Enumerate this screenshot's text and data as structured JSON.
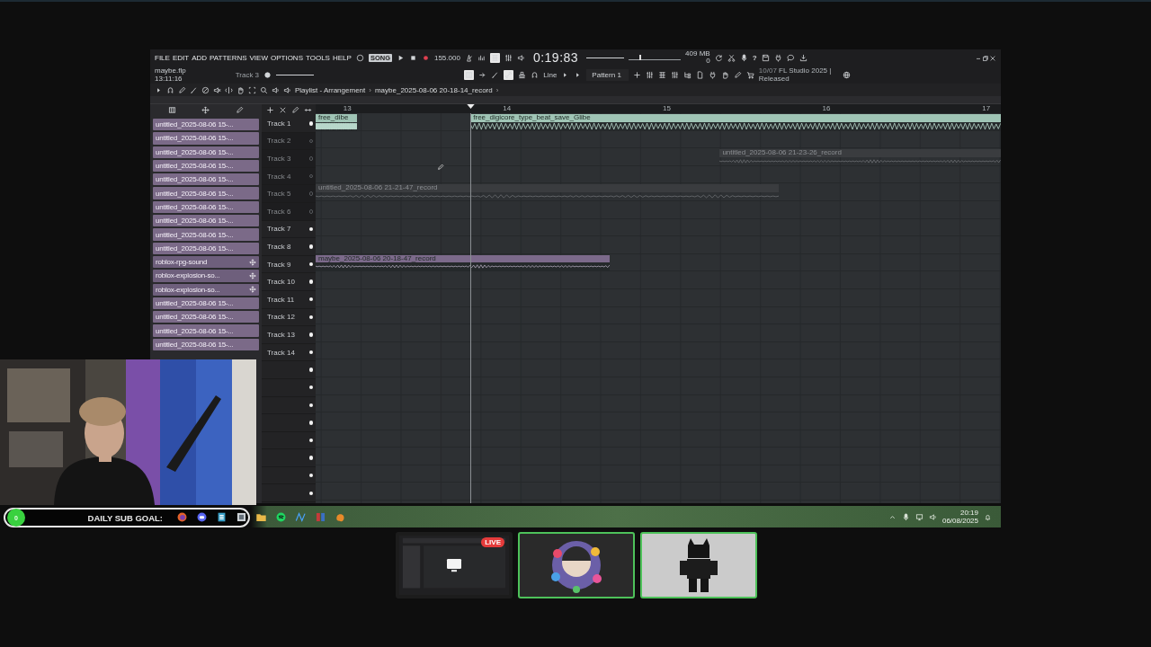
{
  "menu": [
    "FILE",
    "EDIT",
    "ADD",
    "PATTERNS",
    "VIEW",
    "OPTIONS",
    "TOOLS",
    "HELP"
  ],
  "transport": {
    "mode": "SONG",
    "tempo": "155.000",
    "time": "0:19:83"
  },
  "memory": {
    "used": "409 MB",
    "counter": "0"
  },
  "help": "?",
  "file": {
    "name": "maybe.flp",
    "time": "13:11:16"
  },
  "target_track": "Track 3",
  "snap": "Line",
  "pattern": "Pattern 1",
  "news": {
    "date": "10/07",
    "text": "FL Studio 2025 | Released"
  },
  "pitch_slider": {
    "level": 0.2
  },
  "breadcrumb": [
    {
      "text": "Playlist - Arrangement",
      "kind": "crumb"
    },
    {
      "text": "›",
      "kind": "separator"
    },
    {
      "text": "maybe_2025-08-06 20-18-14_record",
      "kind": "crumb"
    },
    {
      "text": "›",
      "kind": "separator"
    }
  ],
  "browser_items": [
    {
      "label": "untitled_2025-08-06 15-...",
      "kind": "pattern"
    },
    {
      "label": "untitled_2025-08-06 15-...",
      "kind": "pattern"
    },
    {
      "label": "untitled_2025-08-06 15-...",
      "kind": "pattern"
    },
    {
      "label": "untitled_2025-08-06 15-...",
      "kind": "pattern"
    },
    {
      "label": "untitled_2025-08-06 15-...",
      "kind": "pattern"
    },
    {
      "label": "untitled_2025-08-06 15-...",
      "kind": "pattern"
    },
    {
      "label": "untitled_2025-08-06 15-...",
      "kind": "pattern"
    },
    {
      "label": "untitled_2025-08-06 15-...",
      "kind": "pattern"
    },
    {
      "label": "untitled_2025-08-06 15-...",
      "kind": "pattern"
    },
    {
      "label": "untitled_2025-08-06 15-...",
      "kind": "pattern"
    },
    {
      "label": "roblox-rpg-sound",
      "kind": "audio"
    },
    {
      "label": "roblox-explosion-so...",
      "kind": "audio"
    },
    {
      "label": "roblox-explosion-so...",
      "kind": "audio"
    },
    {
      "label": "untitled_2025-08-06 15-...",
      "kind": "pattern"
    },
    {
      "label": "untitled_2025-08-06 15-...",
      "kind": "pattern"
    },
    {
      "label": "untitled_2025-08-06 15-...",
      "kind": "pattern"
    },
    {
      "label": "untitled_2025-08-06 15-...",
      "kind": "pattern"
    }
  ],
  "ruler": [
    "13",
    "14",
    "15",
    "16",
    "17"
  ],
  "tracks": [
    {
      "name": "Track 1",
      "muted": false,
      "clips": [
        {
          "name": "free_dibe",
          "color": "#9fc4b5"
        },
        {
          "name": "free_digicore_type_beat_save_Glibe",
          "color": "#9fc4b5"
        }
      ]
    },
    {
      "name": "Track 2",
      "muted": true
    },
    {
      "name": "Track 3",
      "muted": true,
      "clips": [
        {
          "name": "untitled_2025-08-06 21-23-26_record",
          "color": "#3a3c3f"
        }
      ]
    },
    {
      "name": "Track 4",
      "muted": true
    },
    {
      "name": "Track 5",
      "muted": true,
      "clips": [
        {
          "name": "untitled_2025-08-06 21-21-47_record",
          "color": "#3a3c3f"
        }
      ]
    },
    {
      "name": "Track 6",
      "muted": true
    },
    {
      "name": "Track 7",
      "muted": false
    },
    {
      "name": "Track 8",
      "muted": false
    },
    {
      "name": "Track 9",
      "muted": false,
      "clips": [
        {
          "name": "maybe_2025-08-06 20-18-47_record",
          "color": "#7c6a8b"
        }
      ]
    },
    {
      "name": "Track 10",
      "muted": false
    },
    {
      "name": "Track 11",
      "muted": false
    },
    {
      "name": "Track 12",
      "muted": false
    },
    {
      "name": "Track 13",
      "muted": false
    },
    {
      "name": "Track 14",
      "muted": false
    },
    {
      "muted": false
    },
    {
      "muted": false
    },
    {
      "muted": false
    },
    {
      "muted": false
    },
    {
      "muted": false
    },
    {
      "muted": false
    },
    {
      "muted": false
    },
    {
      "muted": false
    }
  ],
  "stream_overlay": {
    "count": "0",
    "label": "DAILY SUB GOAL:"
  },
  "clock": {
    "time": "20:19",
    "date": "06/08/2025"
  },
  "tiles": [
    {
      "kind": "screen",
      "badge": "LIVE",
      "speaking": false
    },
    {
      "kind": "avatar",
      "speaking": true
    },
    {
      "kind": "figure",
      "speaking": true
    }
  ]
}
